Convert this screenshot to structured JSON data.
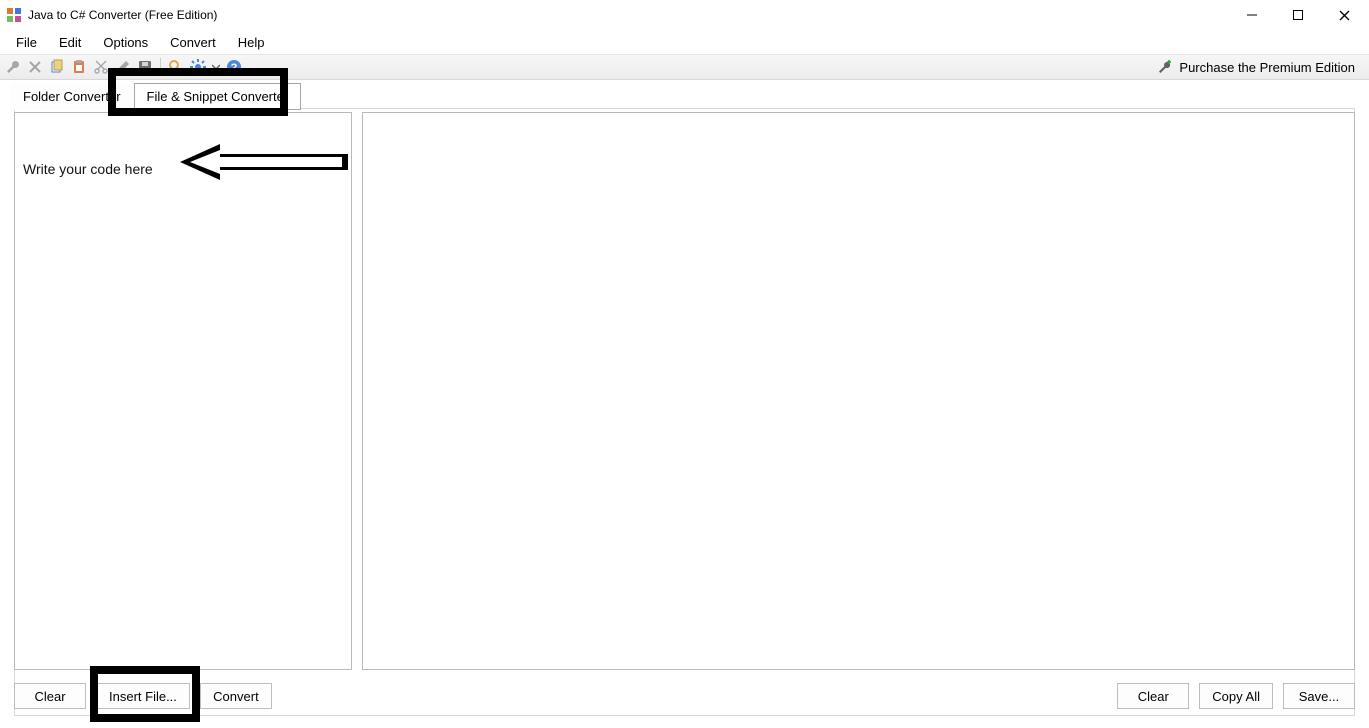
{
  "window": {
    "title": "Java to C# Converter (Free Edition)"
  },
  "menu": {
    "file": "File",
    "edit": "Edit",
    "options": "Options",
    "convert": "Convert",
    "help": "Help"
  },
  "toolbar_icons": {
    "wrench": "wrench-icon",
    "delete": "delete-icon",
    "copy": "copy-icon",
    "paste": "paste-icon",
    "cut": "scissors-icon",
    "edit": "pencil-icon",
    "save": "save-icon",
    "find": "magnifier-icon",
    "settings": "gear-icon",
    "dropdown": "chevron-down-icon",
    "help": "help-icon"
  },
  "premium": {
    "label": "Purchase the Premium Edition"
  },
  "tabs": {
    "folder": "Folder Converter",
    "snippet": "File & Snippet Converter"
  },
  "left_pane": {
    "placeholder": "Write your code here"
  },
  "buttons": {
    "clear_left": "Clear",
    "insert_file": "Insert File...",
    "convert": "Convert",
    "clear_right": "Clear",
    "copy_all": "Copy All",
    "save": "Save..."
  }
}
